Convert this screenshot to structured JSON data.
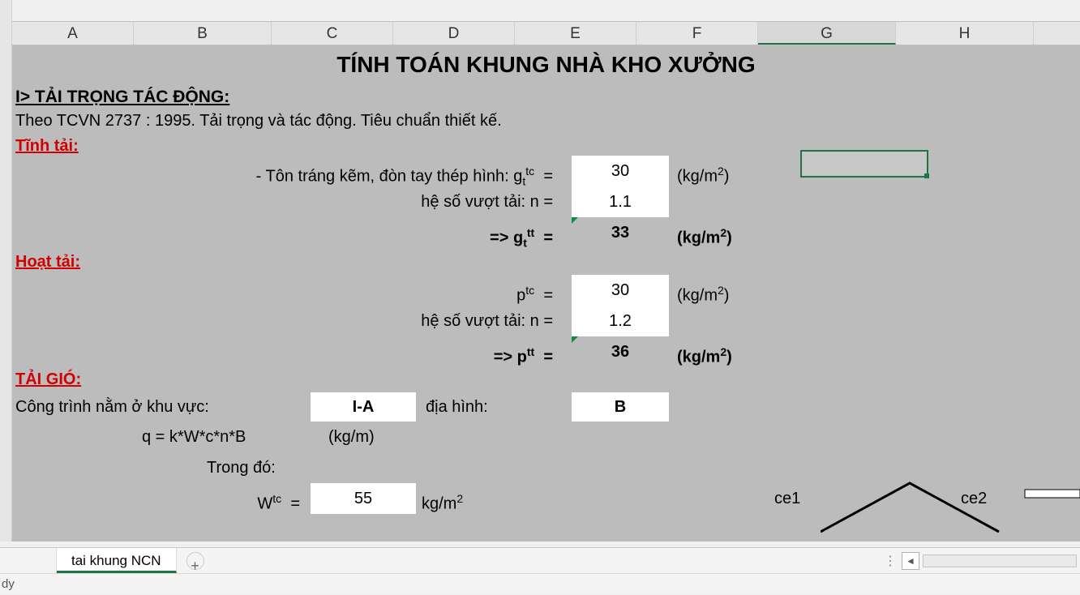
{
  "columns": [
    "A",
    "B",
    "C",
    "D",
    "E",
    "F",
    "G",
    "H"
  ],
  "active_column_index": 6,
  "title": "TÍNH TOÁN KHUNG NHÀ KHO XƯỞNG",
  "section1_heading": "I> TẢI TRỌNG TÁC ĐỘNG:",
  "standard_note": "Theo TCVN 2737 : 1995. Tải trọng và tác động. Tiêu chuẩn thiết kế.",
  "tinh_tai": {
    "heading": "Tĩnh tải:",
    "r1_label_prefix": "- Tôn tráng kẽm, đòn tay thép hình: g",
    "r1_sub": "t",
    "r1_sup": "tc",
    "eq": "=",
    "r1_value": "30",
    "r1_unit_open": "(kg/m",
    "r1_unit_sup": "2",
    "r1_unit_close": ")",
    "r2_label": "hệ số vượt tải: n =",
    "r2_value": "1.1",
    "r3_prefix": "=> g",
    "r3_sub": "t",
    "r3_sup": "tt",
    "r3_value": "33",
    "r3_unit_open": "(kg/m",
    "r3_unit_sup": "2",
    "r3_unit_close": ")"
  },
  "hoat_tai": {
    "heading": "Hoạt tải:",
    "r1_label": "p",
    "r1_sup": "tc",
    "r1_value": "30",
    "unit_open": "(kg/m",
    "unit_sup": "2",
    "unit_close": ")",
    "r2_label": "hệ số vượt tải: n =",
    "r2_value": "1.2",
    "r3_prefix": "=> p",
    "r3_sup": "tt",
    "r3_value": "36"
  },
  "tai_gio": {
    "heading": "TẢI GIÓ:",
    "zone_label": "Công trình nằm ở khu vực:",
    "zone_value": "I-A",
    "terrain_label": "địa hình:",
    "terrain_value": "B",
    "formula_label": "q = k*W*c*n*B",
    "formula_unit": "(kg/m)",
    "in_which": "Trong đó:",
    "w_label": "W",
    "w_sup": "tc",
    "w_value": "55",
    "w_unit": "kg/m",
    "w_unit_sup": "2",
    "ce1": "ce1",
    "ce2": "ce2"
  },
  "sheet_tab": "tai khung NCN",
  "status_text": "dy"
}
